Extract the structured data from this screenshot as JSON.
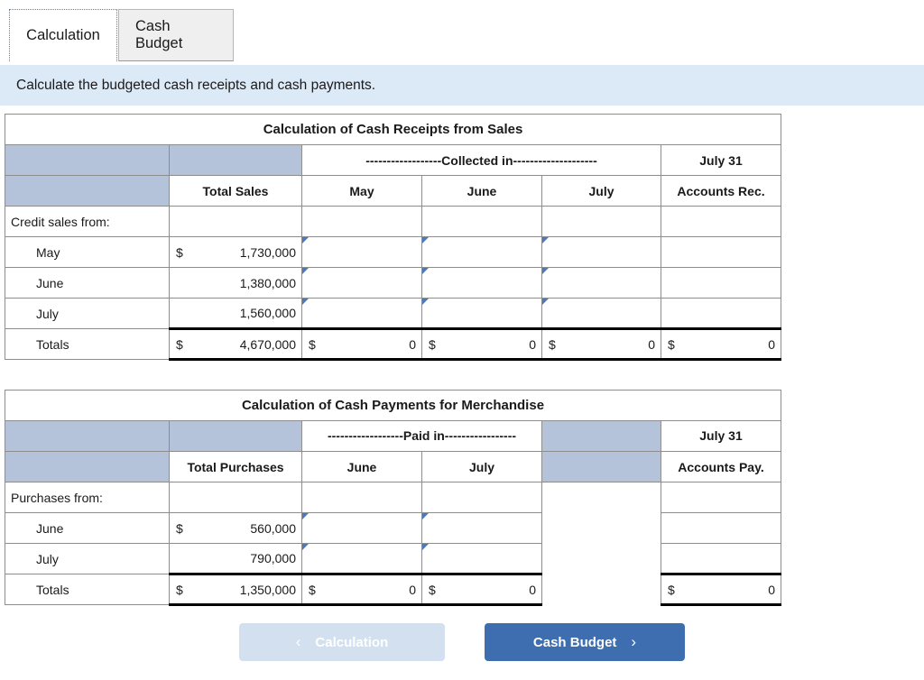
{
  "tabs": [
    {
      "label": "Calculation",
      "active": true
    },
    {
      "label": "Cash Budget",
      "active": false
    }
  ],
  "instruction": "Calculate the budgeted cash receipts and cash payments.",
  "table1": {
    "title": "Calculation of Cash Receipts from Sales",
    "group_header": "------------------Collected in--------------------",
    "right_header_top": "July 31",
    "right_header_bottom": "Accounts Rec.",
    "col_headers": [
      "",
      "Total Sales",
      "May",
      "June",
      "July"
    ],
    "section_label": "Credit sales from:",
    "rows": [
      {
        "label": "May",
        "dollar": "$",
        "total": "1,730,000"
      },
      {
        "label": "June",
        "dollar": "",
        "total": "1,380,000"
      },
      {
        "label": "July",
        "dollar": "",
        "total": "1,560,000"
      }
    ],
    "totals": {
      "label": "Totals",
      "dollar": "$",
      "total": "4,670,000",
      "may_dollar": "$",
      "may": "0",
      "june_dollar": "$",
      "june": "0",
      "july_dollar": "$",
      "july": "0",
      "ar_dollar": "$",
      "ar": "0"
    }
  },
  "table2": {
    "title": "Calculation of Cash Payments for Merchandise",
    "group_header": "------------------Paid in-----------------",
    "right_header_top": "July 31",
    "right_header_bottom": "Accounts Pay.",
    "col_headers": [
      "",
      "Total Purchases",
      "June",
      "July"
    ],
    "section_label": "Purchases from:",
    "rows": [
      {
        "label": "June",
        "dollar": "$",
        "total": "560,000"
      },
      {
        "label": "July",
        "dollar": "",
        "total": "790,000"
      }
    ],
    "totals": {
      "label": "Totals",
      "dollar": "$",
      "total": "1,350,000",
      "june_dollar": "$",
      "june": "0",
      "july_dollar": "$",
      "july": "0",
      "ap_dollar": "$",
      "ap": "0"
    }
  },
  "nav": {
    "prev_label": "Calculation",
    "prev_chevron": "‹",
    "next_label": "Cash Budget",
    "next_chevron": "›"
  },
  "colors": {
    "title_blue": "#7fa9df",
    "header_grayblue": "#b4c2da",
    "instruction_blue": "#dce9f7",
    "input_border": "#5b84c4",
    "next_button": "#3f6eb0",
    "prev_button": "#d3e0ef"
  }
}
